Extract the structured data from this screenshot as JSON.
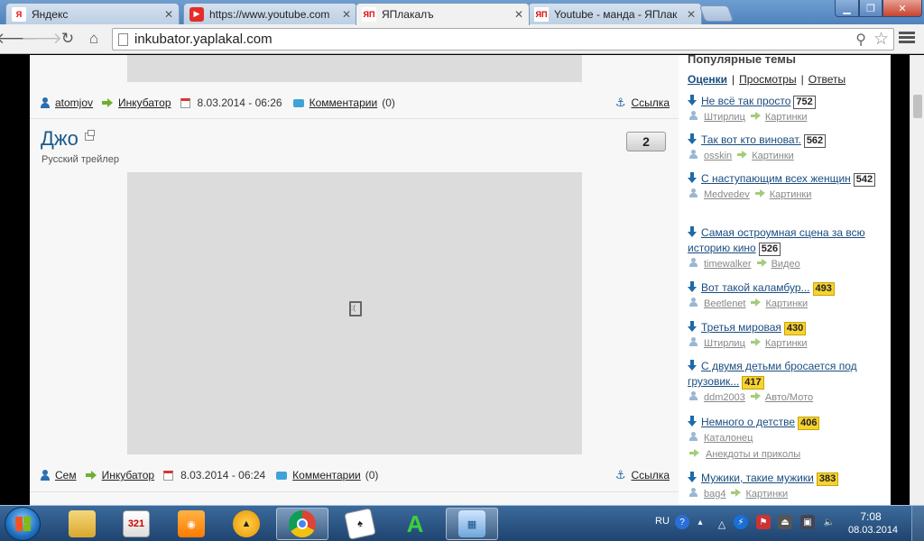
{
  "browser": {
    "tabs": [
      {
        "label": "Яндекс",
        "favicon": "yandex-favicon",
        "active": false
      },
      {
        "label": "https://www.youtube.com",
        "favicon": "youtube-favicon",
        "active": false
      },
      {
        "label": "ЯПлакалъ",
        "favicon": "yaplakal-favicon",
        "active": true
      },
      {
        "label": "Youtube - манда - ЯПлак",
        "favicon": "yaplakal-favicon",
        "active": false
      }
    ],
    "url": "inkubator.yaplakal.com"
  },
  "prev_post": {
    "author": "atomjov",
    "section": "Инкубатор",
    "date": "8.03.2014 - 06:26",
    "comments_label": "Комментарии",
    "comments_count": "(0)",
    "link_label": "Ссылка"
  },
  "post": {
    "title": "Джо",
    "subtitle": "Русский трейлер",
    "rating": "2",
    "author": "Сем",
    "section": "Инкубатор",
    "date": "8.03.2014 - 06:24",
    "comments_label": "Комментарии",
    "comments_count": "(0)",
    "link_label": "Ссылка"
  },
  "sidebar": {
    "title": "Популярные темы",
    "tabs": [
      "Оценки",
      "Просмотры",
      "Ответы"
    ],
    "separator": "|",
    "topics": [
      {
        "title": "Не всё так просто",
        "count": "752",
        "hot": false,
        "author": "Штирлиц",
        "category": "Картинки"
      },
      {
        "title": "Так вот кто виноват.",
        "count": "562",
        "hot": false,
        "author": "osskin",
        "category": "Картинки"
      },
      {
        "title": "С наступающим всех женщин",
        "count": "542",
        "hot": false,
        "author": "Medvedev",
        "category": "Картинки"
      },
      {
        "title": "Самая остроумная сцена за всю историю кино",
        "count": "526",
        "hot": false,
        "author": "timewalker",
        "category": "Видео"
      },
      {
        "title": "Вот такой каламбур...",
        "count": "493",
        "hot": true,
        "author": "Beetlenet",
        "category": "Картинки"
      },
      {
        "title": "Третья мировая",
        "count": "430",
        "hot": true,
        "author": "Штирлиц",
        "category": "Картинки"
      },
      {
        "title": "С двумя детьми бросается под грузовик...",
        "count": "417",
        "hot": true,
        "author": "ddm2003",
        "category": "Авто/Мото"
      },
      {
        "title": "Немного о детстве",
        "count": "406",
        "hot": true,
        "author": "Каталонец",
        "category": "Анекдоты и приколы"
      },
      {
        "title": "Мужики, такие мужики",
        "count": "383",
        "hot": true,
        "author": "bag4",
        "category": "Картинки"
      }
    ]
  },
  "taskbar": {
    "apps": [
      "explorer-icon",
      "321-player-icon",
      "camera-app-icon",
      "aimp-icon",
      "chrome-icon",
      "solitaire-icon",
      "green-a-icon",
      "control-panel-icon"
    ],
    "language": "RU",
    "time": "7:08",
    "date": "08.03.2014"
  },
  "colors": {
    "link_blue": "#1a4d80",
    "hot_badge": "#f7d230",
    "green_arrow": "#6fae2f"
  }
}
